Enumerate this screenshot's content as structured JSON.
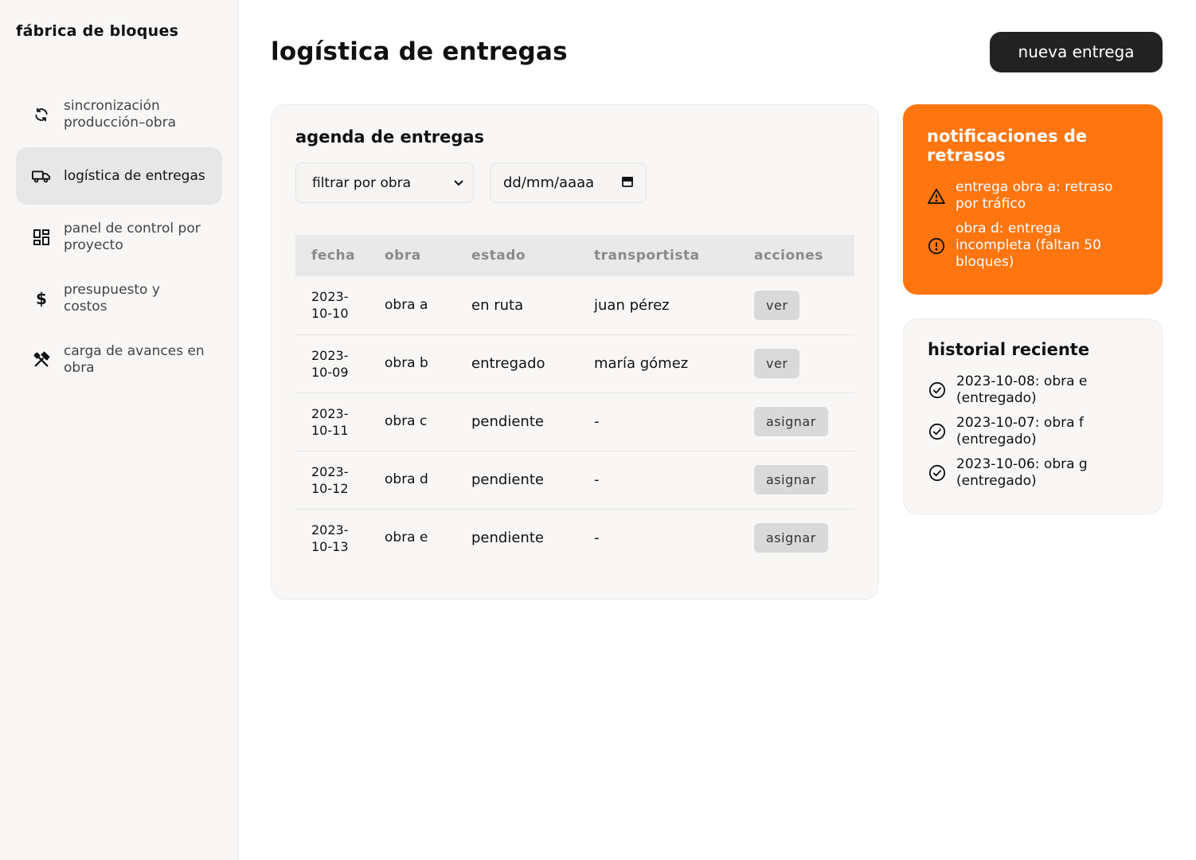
{
  "sidebar": {
    "brand": "fábrica de bloques",
    "items": [
      {
        "icon": "sync-icon",
        "label": "sincronización producción–obra",
        "active": false
      },
      {
        "icon": "truck-icon",
        "label": "logística de entregas",
        "active": true
      },
      {
        "icon": "dashboard-icon",
        "label": "panel de control por proyecto",
        "active": false
      },
      {
        "icon": "dollar-icon",
        "label": "presupuesto y costos",
        "active": false
      },
      {
        "icon": "tools-icon",
        "label": "carga de avances en obra",
        "active": false
      }
    ]
  },
  "header": {
    "title": "logística de entregas",
    "new_button": "nueva entrega"
  },
  "agenda": {
    "title": "agenda de entregas",
    "filter_select": "filtrar por obra",
    "date_placeholder": "dd/mm/aaaa",
    "columns": [
      "fecha",
      "obra",
      "estado",
      "transportista",
      "acciones"
    ],
    "rows": [
      {
        "fecha": "2023-10-10",
        "obra": "obra a",
        "estado": "en ruta",
        "transportista": "juan pérez",
        "accion": "ver"
      },
      {
        "fecha": "2023-10-09",
        "obra": "obra b",
        "estado": "entregado",
        "transportista": "maría gómez",
        "accion": "ver"
      },
      {
        "fecha": "2023-10-11",
        "obra": "obra c",
        "estado": "pendiente",
        "transportista": "-",
        "accion": "asignar"
      },
      {
        "fecha": "2023-10-12",
        "obra": "obra d",
        "estado": "pendiente",
        "transportista": "-",
        "accion": "asignar"
      },
      {
        "fecha": "2023-10-13",
        "obra": "obra e",
        "estado": "pendiente",
        "transportista": "-",
        "accion": "asignar"
      }
    ]
  },
  "notifications": {
    "title": "notificaciones de retrasos",
    "color": "#ff750f",
    "items": [
      {
        "icon": "warning-icon",
        "text": "entrega obra a: retraso por tráfico"
      },
      {
        "icon": "alert-circle-icon",
        "text": "obra d: entrega incompleta (faltan 50 bloques)"
      }
    ]
  },
  "history": {
    "title": "historial reciente",
    "items": [
      {
        "icon": "check-circle-icon",
        "text": "2023-10-08: obra e (entregado)"
      },
      {
        "icon": "check-circle-icon",
        "text": "2023-10-07: obra f (entregado)"
      },
      {
        "icon": "check-circle-icon",
        "text": "2023-10-06: obra g (entregado)"
      }
    ]
  }
}
